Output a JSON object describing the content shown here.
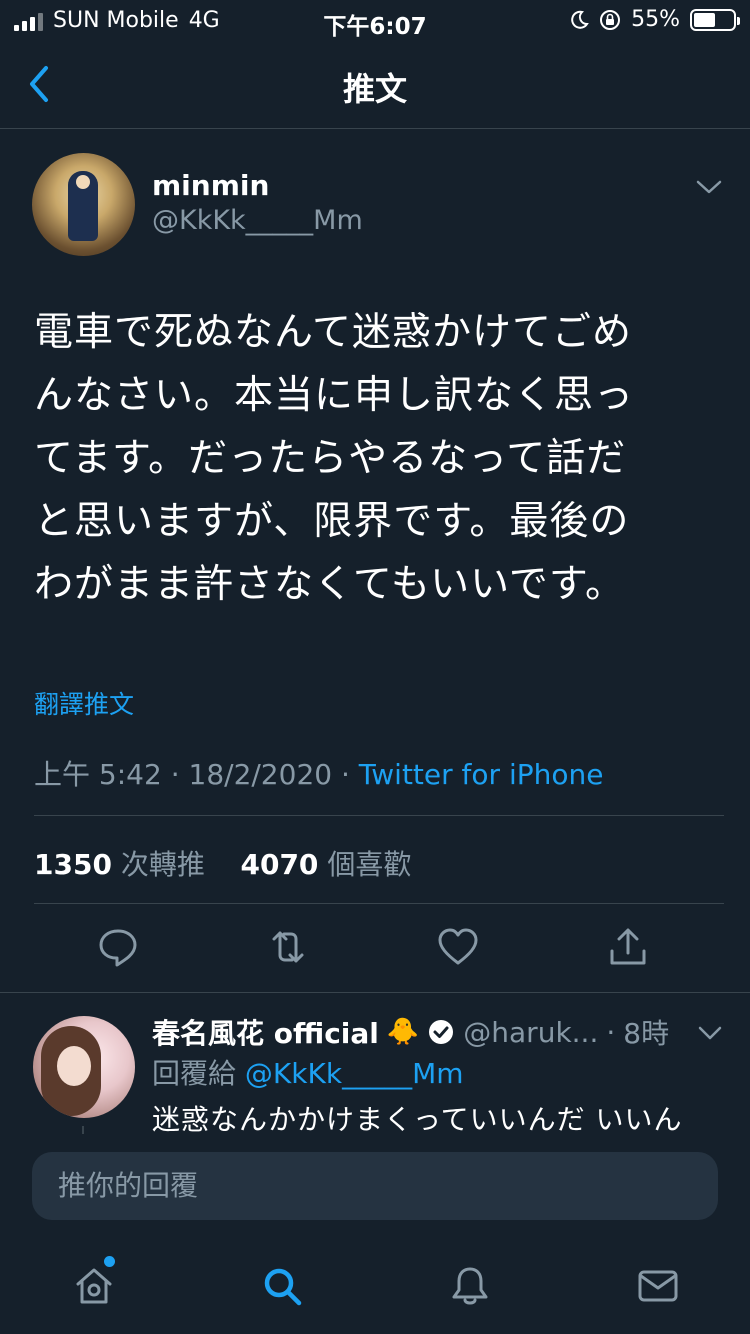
{
  "status_bar": {
    "carrier": "SUN Mobile",
    "network": "4G",
    "time": "下午6:07",
    "battery_percent": "55%",
    "battery_level": 0.55
  },
  "header": {
    "title": "推文"
  },
  "tweet": {
    "display_name": "minmin",
    "handle": "@KkKk_____Mm",
    "text_lines": [
      "電車で死ぬなんて迷惑かけてごめ",
      "んなさい。本当に申し訳なく思っ",
      "てます。だったらやるなって話だ",
      "と思いますが、限界です。最後の",
      "わがまま許さなくてもいいです。"
    ],
    "translate_label": "翻譯推文",
    "time": "上午 5:42",
    "date": "18/2/2020",
    "source": "Twitter for iPhone",
    "retweet_count": "1350",
    "retweet_label": "次轉推",
    "like_count": "4070",
    "like_label": "個喜歡"
  },
  "reply": {
    "display_name": "春名風花 official",
    "emoji": "🐥",
    "handle": "@haruk...",
    "time": "8時",
    "replying_label": "回覆給",
    "replying_to": "@KkKk_____Mm",
    "text": "迷惑なんかかけまくっていいんだ いいん"
  },
  "compose": {
    "placeholder": "推你的回覆"
  },
  "colors": {
    "background": "#15202b",
    "accent": "#1da1f2",
    "secondary_text": "#8899a6",
    "divider": "#38444d"
  },
  "icons": {
    "back": "chevron-left-icon",
    "more": "chevron-down-icon",
    "reply": "comment-icon",
    "retweet": "retweet-icon",
    "like": "heart-icon",
    "share": "share-icon",
    "home": "home-icon",
    "search": "search-icon",
    "notifications": "bell-icon",
    "messages": "mail-icon"
  }
}
